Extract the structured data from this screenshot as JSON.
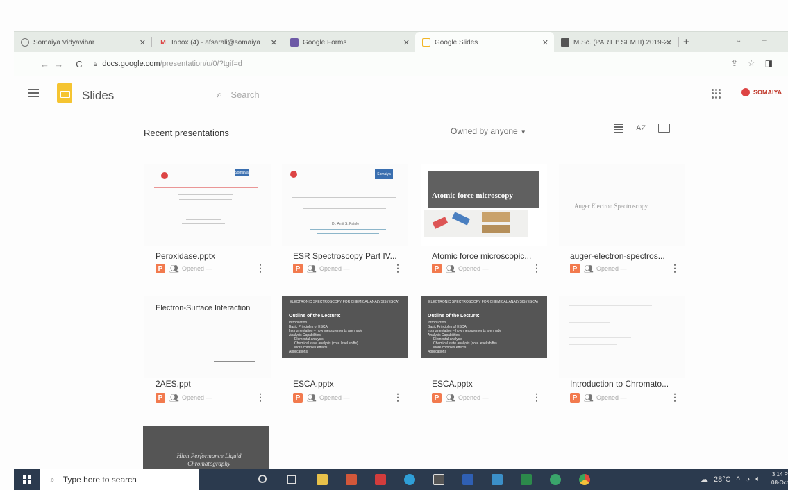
{
  "browser": {
    "tabs": [
      {
        "label": "Somaiya Vidyavihar",
        "icon": "globe-icon"
      },
      {
        "label": "Inbox (4) - afsarali@somaiya",
        "icon": "gmail-icon"
      },
      {
        "label": "Google Forms",
        "icon": "forms-icon"
      },
      {
        "label": "Google Slides",
        "icon": "slides-icon"
      },
      {
        "label": "M.Sc. (PART I: SEM II) 2019-2",
        "icon": "sheet-icon"
      }
    ],
    "new_tab": "+",
    "url_domain": "docs.google.com",
    "url_path": "/presentation/u/0/?tgif=d"
  },
  "app": {
    "title": "Slides",
    "search_placeholder": "Search",
    "brand": "SOMAIYA"
  },
  "list": {
    "heading": "Recent presentations",
    "owner_filter": "Owned by anyone",
    "sort_label": "AZ"
  },
  "files": [
    {
      "name": "Peroxidase.pptx",
      "opened": "Opened —"
    },
    {
      "name": "ESR Spectroscopy Part IV...",
      "opened": "Opened —"
    },
    {
      "name": "Atomic force microscopic...",
      "opened": "Opened —",
      "thumb_title": "Atomic force microscopy"
    },
    {
      "name": "auger-electron-spectros...",
      "opened": "Opened —",
      "thumb_title": "Auger Electron Spectroscopy"
    },
    {
      "name": "2AES.ppt",
      "opened": "Opened —",
      "thumb_title": "Electron-Surface Interaction"
    },
    {
      "name": "ESCA.pptx",
      "opened": "Opened —",
      "thumb_title": "ELECTRONIC SPECTROSCOPY FOR CHEMICAL ANALYSIS (ESCA)",
      "thumb_heading": "Outline of the Lecture:",
      "thumb_items": [
        "Introduction",
        "Basic Principles of ESCA",
        "Instrumentation – how measurements are made",
        "Analysis Capabilities",
        "Elemental analysis",
        "Chemical state analysis (core level shifts)",
        "More complex effects",
        "Applications"
      ]
    },
    {
      "name": "ESCA.pptx",
      "opened": "Opened —",
      "thumb_title": "ELECTRONIC SPECTROSCOPY FOR CHEMICAL ANALYSIS (ESCA)",
      "thumb_heading": "Outline of the Lecture:",
      "thumb_items": [
        "Introduction",
        "Basic Principles of ESCA",
        "Instrumentation – how measurements are made",
        "Analysis Capabilities",
        "Elemental analysis",
        "Chemical state analysis (core level shifts)",
        "More complex effects",
        "Applications"
      ]
    },
    {
      "name": "Introduction to Chromato...",
      "opened": "Opened —"
    },
    {
      "name": "",
      "opened": "",
      "thumb_title": "High Performance Liquid Chromatography"
    }
  ],
  "taskbar": {
    "search_placeholder": "Type here to search",
    "weather": "28°C",
    "time": "3:14 P",
    "date": "08-Oct"
  },
  "thumb_labels": {
    "somaiya_badge": "Somaiya",
    "author": "Dr. Amit S. Patole"
  }
}
